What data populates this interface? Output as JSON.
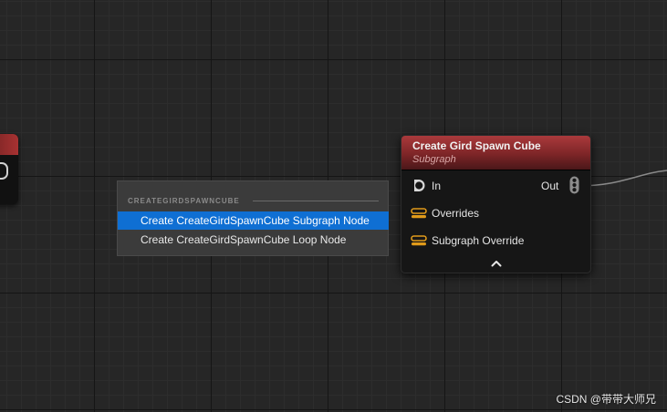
{
  "context_menu": {
    "section_title": "CREATEGIRDSPAWNCUBE",
    "items": [
      {
        "label": "Create CreateGirdSpawnCube Subgraph Node",
        "selected": true
      },
      {
        "label": "Create CreateGirdSpawnCube Loop Node",
        "selected": false
      }
    ]
  },
  "node": {
    "title": "Create Gird Spawn Cube",
    "subtitle": "Subgraph",
    "header_color": "#aa3a3c",
    "input_pins": [
      {
        "label": "In",
        "icon": "exec-pin-icon"
      },
      {
        "label": "Overrides",
        "icon": "param-pin-icon",
        "color": "#e09a1a"
      },
      {
        "label": "Subgraph Override",
        "icon": "param-pin-icon",
        "color": "#e09a1a"
      }
    ],
    "output_pins": [
      {
        "label": "Out",
        "icon": "point-stack-pin-icon"
      }
    ],
    "collapse_icon": "chevron-up-icon"
  },
  "watermark": "CSDN @带带大师兄",
  "colors": {
    "selection": "#0f6fd3",
    "canvas": "#262626",
    "pin_orange": "#e09a1a"
  }
}
